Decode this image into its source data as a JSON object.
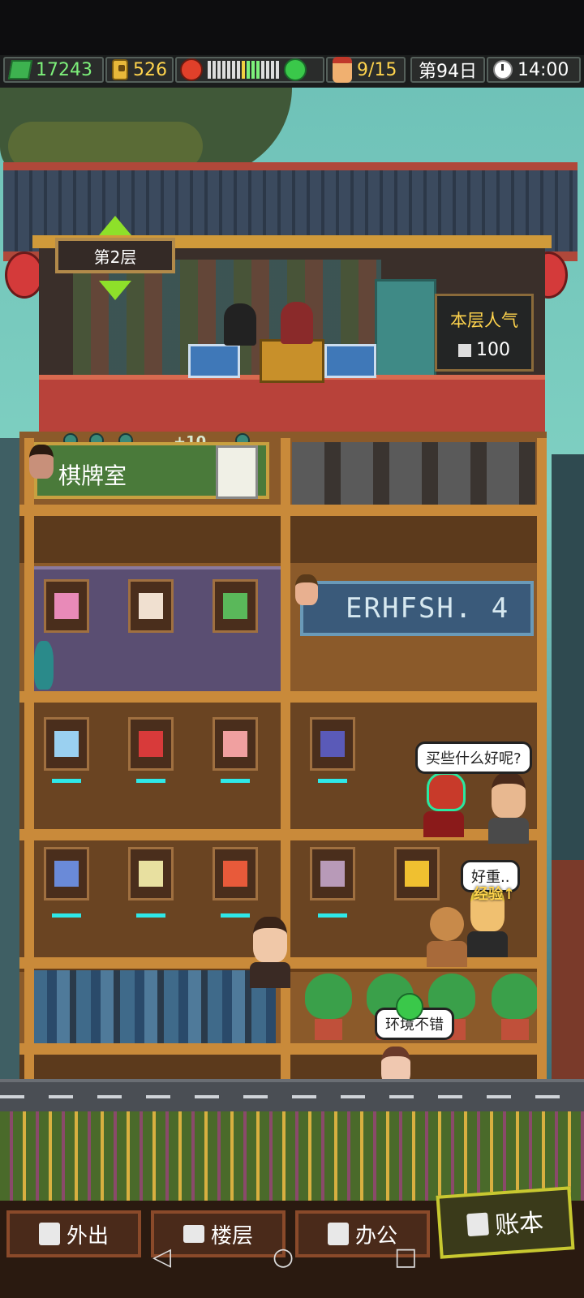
{
  "hud": {
    "cash": "17243",
    "coins": "526",
    "customers": "9/15",
    "day": "第94日",
    "time": "14:00",
    "mood_level": 0.45
  },
  "floor_sign": "第2层",
  "popularity": {
    "label": "本层人气",
    "value": "100"
  },
  "mahjong_room": {
    "label": "棋牌室",
    "reward": "+10"
  },
  "banner_text": "ERHFSH. 4",
  "speech": {
    "bubble1": "买些什么好呢?",
    "bubble2": "好重",
    "bubble2_suffix": "..",
    "bubble3": "环境不错",
    "exp_label": "经验↑"
  },
  "nav": {
    "go_out": "外出",
    "floors": "楼层",
    "office": "办公",
    "ledger": "账本"
  },
  "system_nav": {
    "back": "◁",
    "home": "○",
    "recents": "□"
  },
  "colors": {
    "accent_green": "#7df07a",
    "gold": "#ffd44d",
    "shelf_glow": "#2ee8e8"
  }
}
